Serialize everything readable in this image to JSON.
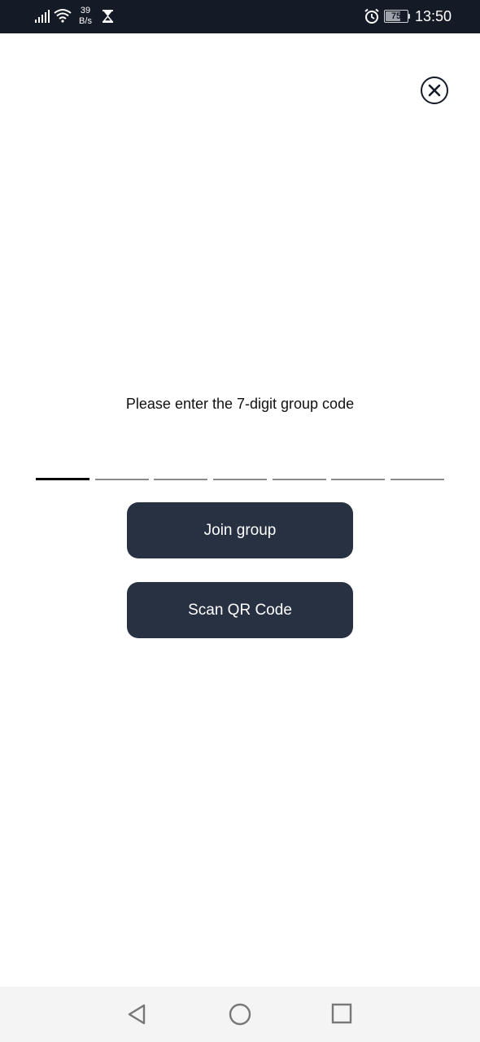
{
  "status_bar": {
    "net_speed_value": "39",
    "net_speed_unit": "B/s",
    "battery_level": "75",
    "time": "13:50",
    "icons": [
      "signal-icon",
      "wifi-icon",
      "hourglass-icon",
      "alarm-icon",
      "battery-icon"
    ]
  },
  "dialog": {
    "close_icon": "close-icon",
    "prompt": "Please enter the 7-digit group code",
    "code_input": {
      "length": 7,
      "active_index": 0,
      "digits": [
        "",
        "",
        "",
        "",
        "",
        "",
        ""
      ]
    },
    "join_button_label": "Join group",
    "scan_button_label": "Scan QR Code"
  },
  "nav_bar": {
    "icons": [
      "back-icon",
      "home-icon",
      "recents-icon"
    ]
  },
  "colors": {
    "status_bar_bg": "#151b26",
    "button_bg": "#283142",
    "button_text": "#ffffff",
    "active_underline": "#000000",
    "inactive_underline": "#8a8a8a",
    "nav_bar_bg": "#f4f4f4"
  }
}
